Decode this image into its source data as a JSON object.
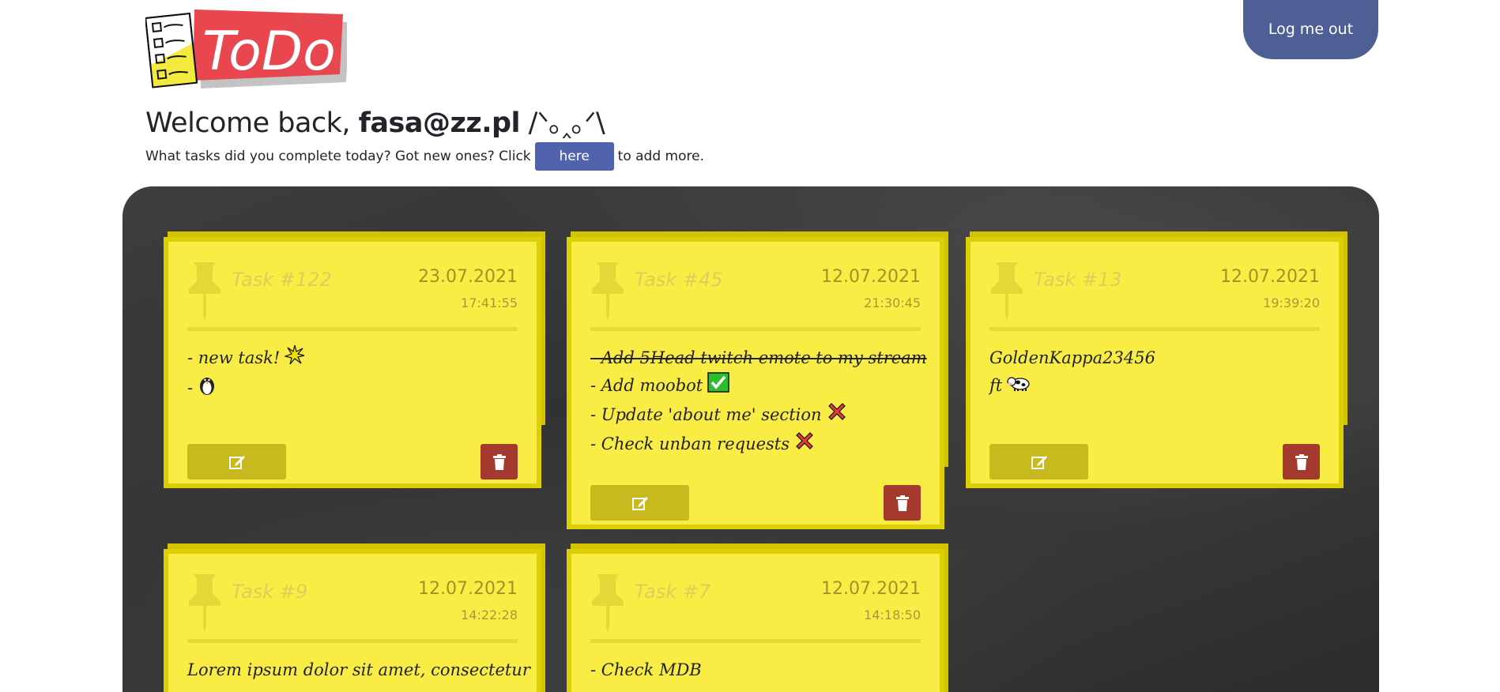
{
  "header": {
    "logo_text": "ToDo",
    "logout_label": "Log me out"
  },
  "welcome": {
    "prefix": "Welcome back, ",
    "user": "fasa@zz.pl",
    "emoticon": " /ᐠ｡‸｡ᐟ\\"
  },
  "prompt": {
    "before": "What tasks did you complete today? Got new ones? Click",
    "button_label": "here",
    "after": "to add more."
  },
  "colors": {
    "note": "#f9ed45",
    "note_border": "#dccf05",
    "edit": "#c8b91f",
    "delete": "#a33a2d",
    "accent": "#4e5f95"
  },
  "tasks": [
    {
      "title": "Task #122",
      "date": "23.07.2021",
      "time": "17:41:55",
      "lines": [
        {
          "text": "- new task!",
          "emoji": "sparkle-icon",
          "done": false
        },
        {
          "text": "-",
          "emoji": "penguin-icon",
          "done": false
        }
      ]
    },
    {
      "title": "Task #45",
      "date": "12.07.2021",
      "time": "21:30:45",
      "lines": [
        {
          "text": "- Add 5Head twitch emote to my stream",
          "emoji": "",
          "done": true
        },
        {
          "text": "- Add moobot",
          "emoji": "check-mark-icon",
          "done": false
        },
        {
          "text": "- Update 'about me' section",
          "emoji": "cross-mark-icon",
          "done": false
        },
        {
          "text": "- Check unban requests",
          "emoji": "cross-mark-icon",
          "done": false
        }
      ]
    },
    {
      "title": "Task #13",
      "date": "12.07.2021",
      "time": "19:39:20",
      "lines": [
        {
          "text": "GoldenKappa23456",
          "emoji": "",
          "done": false
        },
        {
          "text": "ft",
          "emoji": "cow-icon",
          "done": false
        }
      ]
    },
    {
      "title": "Task #9",
      "date": "12.07.2021",
      "time": "14:22:28",
      "lines": [
        {
          "text": "Lorem ipsum dolor sit amet, consectetur",
          "emoji": "",
          "done": false
        }
      ]
    },
    {
      "title": "Task #7",
      "date": "12.07.2021",
      "time": "14:18:50",
      "lines": [
        {
          "text": "- Check MDB",
          "emoji": "",
          "done": false
        }
      ]
    }
  ]
}
